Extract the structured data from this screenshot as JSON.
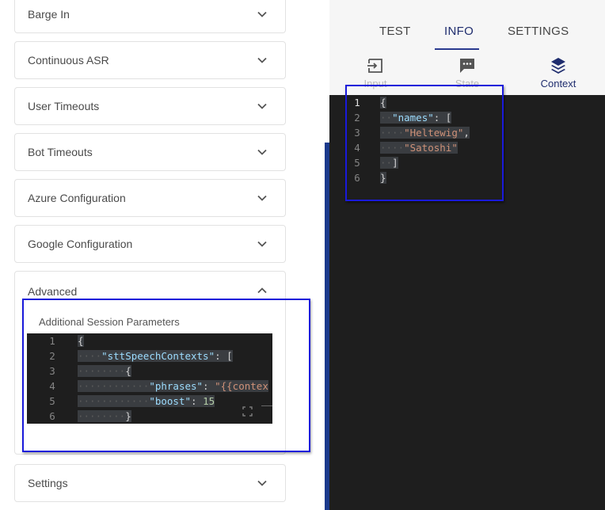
{
  "accordion": {
    "items": [
      {
        "label": "Barge In"
      },
      {
        "label": "Continuous ASR"
      },
      {
        "label": "User Timeouts"
      },
      {
        "label": "Bot Timeouts"
      },
      {
        "label": "Azure Configuration"
      },
      {
        "label": "Google Configuration"
      }
    ],
    "advanced": {
      "label": "Advanced",
      "field_label": "Additional Session Parameters",
      "editor": {
        "line_numbers": [
          "1",
          "2",
          "3",
          "4",
          "5",
          "6"
        ],
        "lines": [
          [
            "{"
          ],
          [
            "\"sttSpeechContexts\"",
            ": ["
          ],
          [
            "{"
          ],
          [
            "\"phrases\"",
            ": ",
            "\"{{contex"
          ],
          [
            "\"boost\"",
            ": ",
            "15"
          ],
          [
            "}"
          ]
        ]
      }
    },
    "settings": {
      "label": "Settings"
    }
  },
  "right_panel": {
    "tabs": [
      {
        "label": "TEST"
      },
      {
        "label": "INFO"
      },
      {
        "label": "SETTINGS"
      }
    ],
    "active_tab": "INFO",
    "subtabs": [
      {
        "label": "Input",
        "icon": "input-icon"
      },
      {
        "label": "State",
        "icon": "chat-icon"
      },
      {
        "label": "Context",
        "icon": "layers-icon"
      }
    ],
    "active_subtab": "Context",
    "editor": {
      "line_numbers": [
        "1",
        "2",
        "3",
        "4",
        "5",
        "6"
      ],
      "lines": [
        [
          "{"
        ],
        [
          "\"names\"",
          ": ["
        ],
        [
          "\"Heltewig\"",
          ","
        ],
        [
          "\"Satoshi\""
        ],
        [
          "]"
        ],
        [
          "}"
        ]
      ]
    }
  },
  "colors": {
    "accent": "#2a3a8f",
    "highlight_box": "#1a1adb",
    "editor_bg": "#1e1e1e",
    "key": "#9cdcfe",
    "string": "#ce9178",
    "number": "#b5cea8"
  }
}
